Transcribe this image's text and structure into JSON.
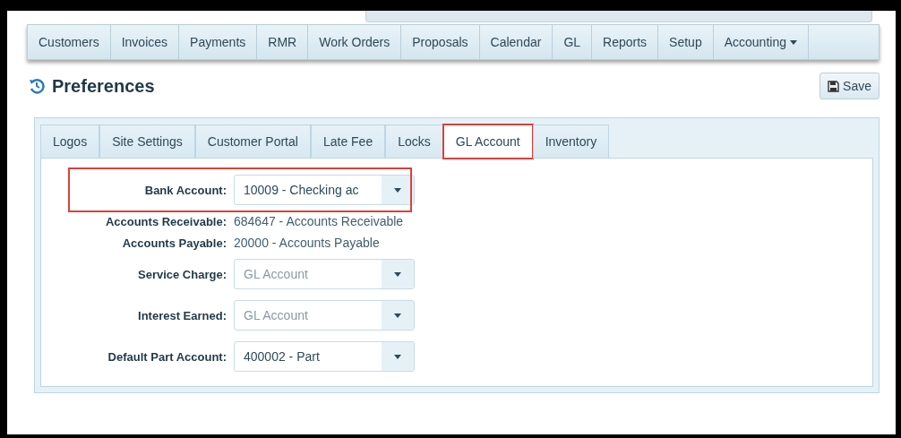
{
  "nav": [
    {
      "label": "Customers",
      "kind": "link"
    },
    {
      "label": "Invoices",
      "kind": "link"
    },
    {
      "label": "Payments",
      "kind": "link"
    },
    {
      "label": "RMR",
      "kind": "link"
    },
    {
      "label": "Work Orders",
      "kind": "link"
    },
    {
      "label": "Proposals",
      "kind": "link"
    },
    {
      "label": "Calendar",
      "kind": "link"
    },
    {
      "label": "GL",
      "kind": "link"
    },
    {
      "label": "Reports",
      "kind": "link"
    },
    {
      "label": "Setup",
      "kind": "link"
    },
    {
      "label": "Accounting",
      "kind": "dropdown"
    }
  ],
  "page": {
    "title": "Preferences",
    "save_button": "Save"
  },
  "tabs": [
    {
      "label": "Logos",
      "selected": false,
      "highlighted": false
    },
    {
      "label": "Site Settings",
      "selected": false,
      "highlighted": false
    },
    {
      "label": "Customer Portal",
      "selected": false,
      "highlighted": false
    },
    {
      "label": "Late Fee",
      "selected": false,
      "highlighted": false
    },
    {
      "label": "Locks",
      "selected": false,
      "highlighted": false
    },
    {
      "label": "GL Account",
      "selected": true,
      "highlighted": true
    },
    {
      "label": "Inventory",
      "selected": false,
      "highlighted": false
    }
  ],
  "fields": [
    {
      "label": "Bank Account:",
      "kind": "select",
      "value": "10009 - Checking ac",
      "placeholder_shown": false,
      "highlighted": true
    },
    {
      "label": "Accounts Receivable:",
      "kind": "text",
      "value": "684647 - Accounts Receivable",
      "highlighted": false
    },
    {
      "label": "Accounts Payable:",
      "kind": "text",
      "value": "20000 - Accounts Payable",
      "highlighted": false
    },
    {
      "label": "Service Charge:",
      "kind": "select",
      "placeholder": "GL Account",
      "placeholder_shown": true,
      "highlighted": false
    },
    {
      "label": "Interest Earned:",
      "kind": "select",
      "placeholder": "GL Account",
      "placeholder_shown": true,
      "highlighted": false
    },
    {
      "label": "Default Part Account:",
      "kind": "select",
      "value": "400002 - Part",
      "placeholder_shown": false,
      "highlighted": false
    }
  ]
}
